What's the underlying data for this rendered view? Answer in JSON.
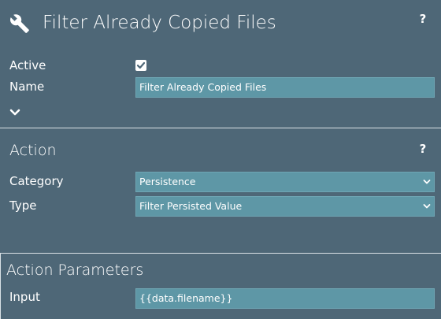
{
  "header": {
    "title": "Filter Already Copied Files",
    "icon": "wrench-icon",
    "help_label": "?"
  },
  "general": {
    "active_label": "Active",
    "active_checked": true,
    "name_label": "Name",
    "name_value": "Filter Already Copied Files",
    "expand_icon": "chevron-down-icon"
  },
  "action": {
    "section_title": "Action",
    "help_label": "?",
    "category_label": "Category",
    "category_value": "Persistence",
    "type_label": "Type",
    "type_value": "Filter Persisted Value"
  },
  "action_parameters": {
    "section_title": "Action Parameters",
    "input_label": "Input",
    "input_value": "{{data.filename}}"
  },
  "colors": {
    "background": "#4e6777",
    "field_background": "#5e97a6",
    "divider": "#d9e1e6",
    "text": "#ffffff"
  }
}
